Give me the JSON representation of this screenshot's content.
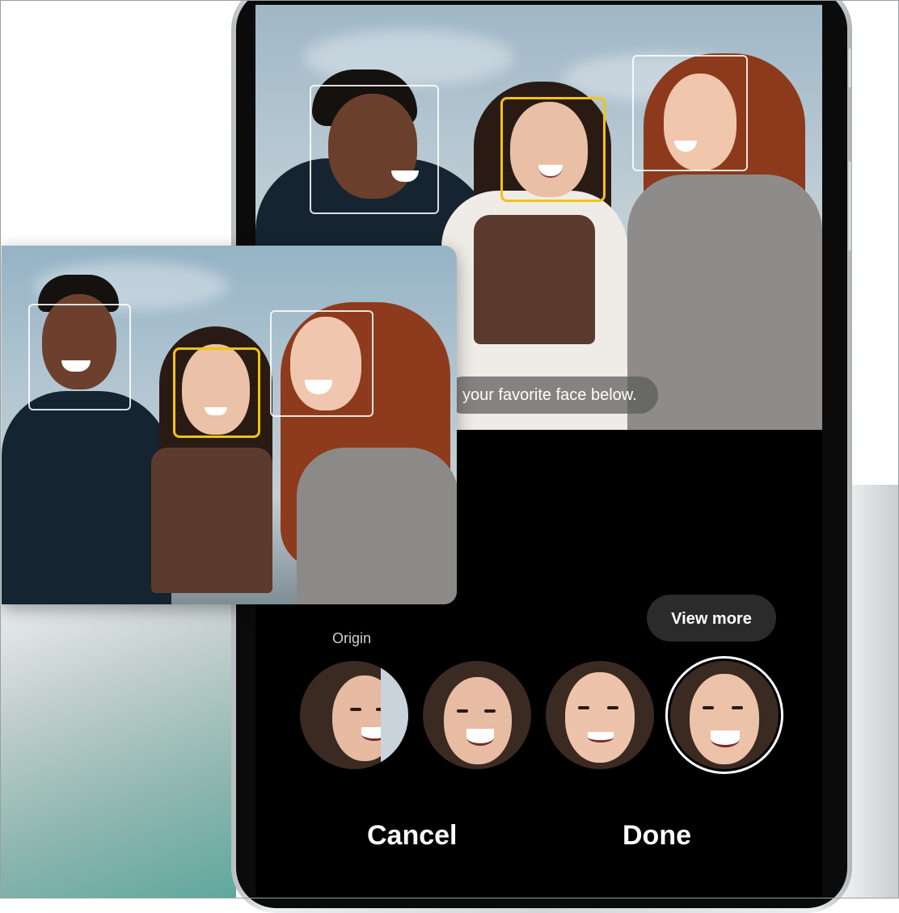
{
  "hint": {
    "text": "your favorite face below."
  },
  "controls": {
    "view_more_label": "View more",
    "origin_label": "Origin",
    "cancel_label": "Cancel",
    "done_label": "Done"
  },
  "thumbnails": [
    {
      "name": "origin",
      "selected": false
    },
    {
      "name": "option-2",
      "selected": false
    },
    {
      "name": "option-3",
      "selected": false
    },
    {
      "name": "option-4",
      "selected": true
    }
  ],
  "colors": {
    "selection_yellow": "#f2c311",
    "selection_white": "#ffffff",
    "screen_bg": "#000000"
  }
}
